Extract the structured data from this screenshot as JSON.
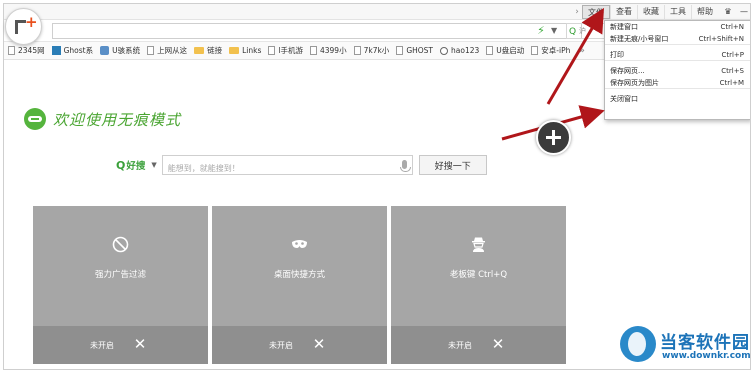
{
  "menubar": {
    "items": [
      "文件",
      "查看",
      "收藏",
      "工具",
      "帮助"
    ],
    "active_index": 0
  },
  "address": {
    "search_placeholder": "沪"
  },
  "bookmarks": [
    {
      "icon": "page-icon",
      "label": "2345网"
    },
    {
      "icon": "ghost-icon",
      "label": "Ghost系"
    },
    {
      "icon": "u-icon",
      "label": "U骇系统"
    },
    {
      "icon": "page-icon",
      "label": "上网从这"
    },
    {
      "icon": "folder-icon",
      "label": "链接"
    },
    {
      "icon": "folder-icon",
      "label": "Links"
    },
    {
      "icon": "page-icon",
      "label": "l手机游"
    },
    {
      "icon": "page-icon",
      "label": "4399小"
    },
    {
      "icon": "page-icon",
      "label": "7k7k小"
    },
    {
      "icon": "page-icon",
      "label": "GHOST"
    },
    {
      "icon": "hao-icon",
      "label": "hao123"
    },
    {
      "icon": "page-icon",
      "label": "U盘启动"
    },
    {
      "icon": "page-icon",
      "label": "安卓-iPh"
    }
  ],
  "bookmarks_more": "»",
  "welcome": {
    "title": "欢迎使用无痕模式"
  },
  "search": {
    "engine_label": "好搜",
    "placeholder": "能想到，就能搜到！",
    "button_label": "好搜一下"
  },
  "cards": [
    {
      "icon": "block-icon",
      "title": "强力广告过滤",
      "status": "未开启",
      "close": "✕"
    },
    {
      "icon": "mask-icon",
      "title": "桌面快捷方式",
      "status": "未开启",
      "close": "✕"
    },
    {
      "icon": "boss-icon",
      "title": "老板键 Ctrl+Q",
      "status": "未开启",
      "close": "✕"
    }
  ],
  "dropdown": {
    "items": [
      {
        "label": "新建窗口",
        "shortcut": "Ctrl+N"
      },
      {
        "label": "新建无痕/小号窗口",
        "shortcut": "Ctrl+Shift+N"
      },
      {
        "label": "打印",
        "shortcut": "Ctrl+P"
      },
      {
        "label": "保存网页...",
        "shortcut": "Ctrl+S"
      },
      {
        "label": "保存网页为图片",
        "shortcut": "Ctrl+M"
      },
      {
        "label": "关闭窗口",
        "shortcut": ""
      }
    ]
  },
  "watermark": {
    "name": "当客软件园",
    "url": "www.downkr.com"
  },
  "colors": {
    "accent_green": "#4aa532",
    "card_gray": "#a6a6a6",
    "arrow_red": "#b0161a",
    "watermark_blue": "#1c73b8"
  }
}
